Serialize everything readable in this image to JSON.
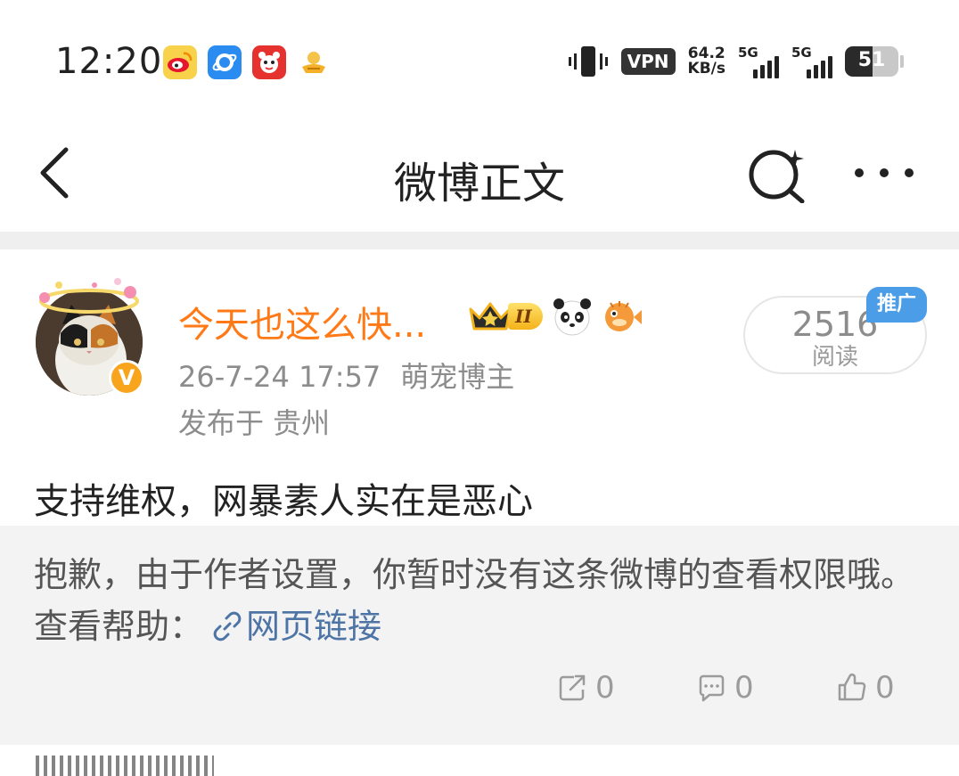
{
  "status_bar": {
    "time": "12:20",
    "vpn": "VPN",
    "speed_value": "64.2",
    "speed_unit": "KB/s",
    "sim1": "5G",
    "sim2": "5G",
    "battery": "51",
    "battery_level": 0.51
  },
  "nav": {
    "title": "微博正文"
  },
  "post": {
    "username": "今天也这么快...",
    "level": "II",
    "timestamp": "26-7-24 17:57",
    "role": "萌宠博主",
    "location": "发布于 贵州",
    "reads_count": "2516",
    "reads_label": "阅读",
    "promo_label": "推广",
    "verified_badge": "V",
    "text": "支持维权，网暴素人实在是恶心"
  },
  "notice": {
    "text": "抱歉，由于作者设置，你暂时没有这条微博的查看权限哦。查看帮助：",
    "link_text": "网页链接"
  },
  "actions": {
    "repost_count": "0",
    "comment_count": "0",
    "like_count": "0"
  },
  "colors": {
    "username": "#ff7a16",
    "link": "#4e74a6",
    "promo": "#4b9de8",
    "verified": "#f8a51d"
  }
}
